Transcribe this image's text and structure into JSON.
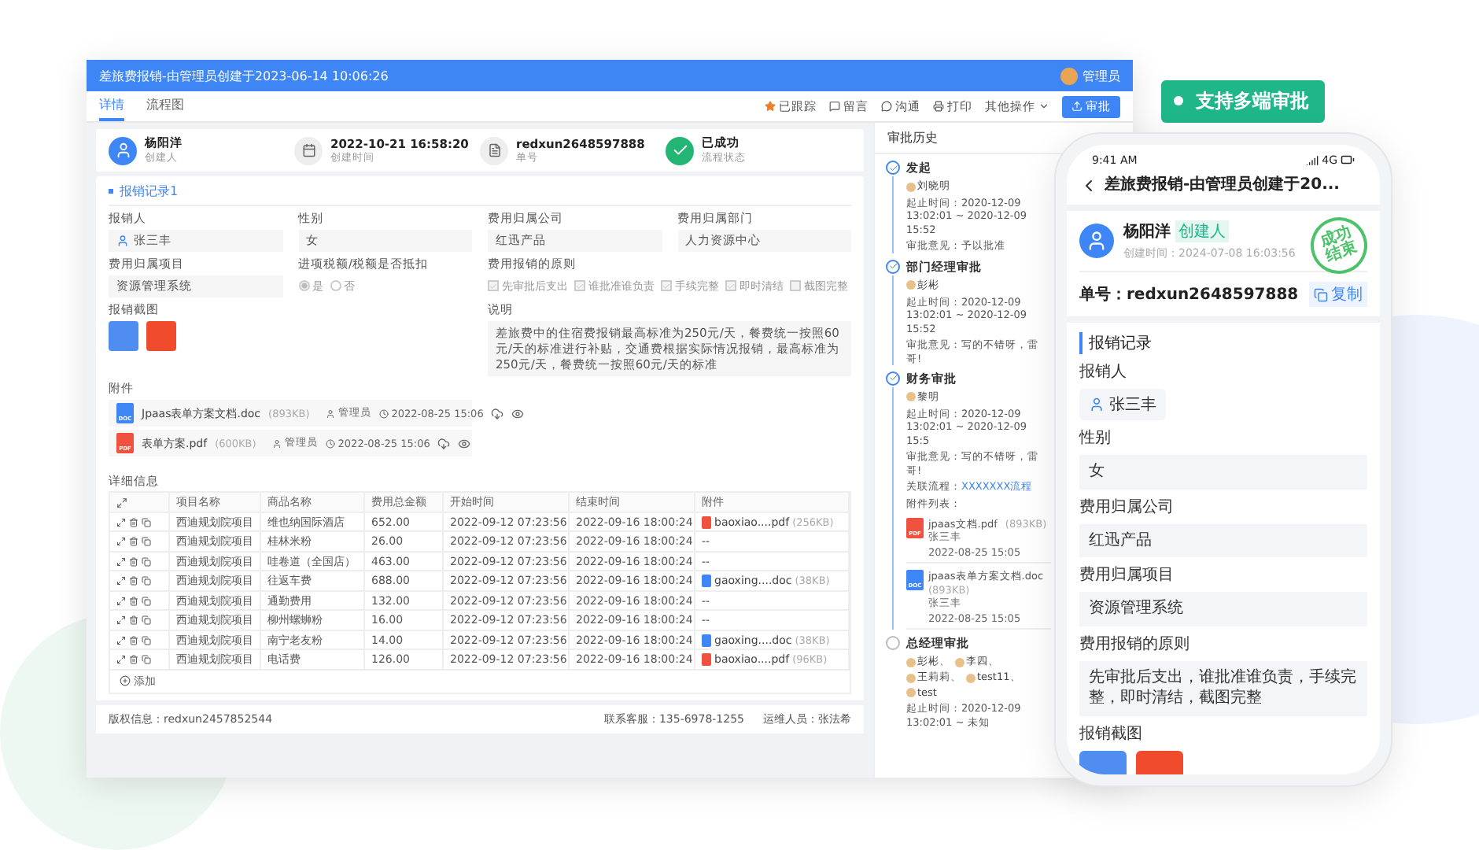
{
  "badge": "支持多端审批",
  "window": {
    "title": "差旅费报销-由管理员创建于2023-06-14 10:06:26",
    "user": "管理员"
  },
  "tabs": [
    {
      "label": "详情",
      "selected": true
    },
    {
      "label": "流程图",
      "selected": false
    }
  ],
  "toolbar": {
    "actions": [
      {
        "kind": "star",
        "label": "已跟踪"
      },
      {
        "kind": "message",
        "label": "留言"
      },
      {
        "kind": "chat",
        "label": "沟通"
      },
      {
        "kind": "print",
        "label": "打印"
      }
    ],
    "more": "其他操作",
    "primary": "审批"
  },
  "summary": [
    {
      "kind": "avatar",
      "value": "杨阳洋",
      "label": "创建人"
    },
    {
      "kind": "calendar",
      "value": "2022-10-21 16:58:20",
      "label": "创建时间"
    },
    {
      "kind": "doc",
      "value": "redxun2648597888",
      "label": "单号"
    },
    {
      "kind": "status",
      "value": "已成功",
      "label": "流程状态"
    }
  ],
  "section": "报销记录1",
  "fields": [
    {
      "kind": "person",
      "label": "报销人",
      "value": "张三丰"
    },
    {
      "kind": "text",
      "label": "性别",
      "value": "女"
    },
    {
      "kind": "text",
      "label": "费用归属公司",
      "value": "红迅产品"
    },
    {
      "kind": "text",
      "label": "费用归属部门",
      "value": "人力资源中心"
    },
    {
      "kind": "text",
      "label": "费用归属项目",
      "value": "资源管理系统"
    },
    {
      "kind": "radio",
      "label": "进项税额/税额是否抵扣",
      "options": [
        {
          "label": "是",
          "selected": true
        },
        {
          "label": "否",
          "selected": false
        }
      ]
    },
    {
      "kind": "checkbox",
      "label": "费用报销的原则",
      "options": [
        {
          "label": "先审批后支出",
          "checked": true
        },
        {
          "label": "谁批准谁负责",
          "checked": true
        },
        {
          "label": "手续完整",
          "checked": true
        },
        {
          "label": "即时清结",
          "checked": true
        },
        {
          "label": "截图完整",
          "checked": false
        }
      ]
    },
    {
      "kind": "images",
      "label": "报销截图"
    },
    {
      "kind": "note",
      "label": "说明",
      "value": "差旅费中的住宿费报销最高标准为250元/天，餐费统一按照60元/天的标准进行补贴，交通费根据实际情况报销，最高标准为250元/天，餐费统一按照60元/天的标准"
    }
  ],
  "attachments": {
    "label": "附件",
    "files": [
      {
        "kind": "doc",
        "icon": "DOC",
        "name": "Jpaas表单方案文档.doc",
        "size": "(893KB)",
        "owner": "管理员",
        "time": "2022-08-25 15:06"
      },
      {
        "kind": "pdf",
        "icon": "PDF",
        "name": "表单方案.pdf",
        "size": "(600KB)",
        "owner": "管理员",
        "time": "2022-08-25 15:06"
      }
    ]
  },
  "details": {
    "label": "详细信息",
    "columns": [
      "项目名称",
      "商品名称",
      "费用总金额",
      "开始时间",
      "结束时间",
      "附件"
    ],
    "rows": [
      {
        "project": "西迪规划院项目",
        "item": "维也纳国际酒店",
        "amount": "652.00",
        "start": "2022-09-12 07:23:56",
        "end": "2022-09-16 18:00:24",
        "file": {
          "kind": "pdf",
          "name": "baoxiao....pdf",
          "size": "(256KB)"
        }
      },
      {
        "project": "西迪规划院项目",
        "item": "桂林米粉",
        "amount": "26.00",
        "start": "2022-09-12 07:23:56",
        "end": "2022-09-16 18:00:24",
        "file": {
          "name": "--"
        }
      },
      {
        "project": "西迪规划院项目",
        "item": "哇卷道（全国店）",
        "amount": "463.00",
        "start": "2022-09-12 07:23:56",
        "end": "2022-09-16 18:00:24",
        "file": {
          "name": "--"
        }
      },
      {
        "project": "西迪规划院项目",
        "item": "往返车费",
        "amount": "688.00",
        "start": "2022-09-12 07:23:56",
        "end": "2022-09-16 18:00:24",
        "file": {
          "kind": "doc",
          "name": "gaoxing....doc",
          "size": "(38KB)"
        }
      },
      {
        "project": "西迪规划院项目",
        "item": "通勤费用",
        "amount": "132.00",
        "start": "2022-09-12 07:23:56",
        "end": "2022-09-16 18:00:24",
        "file": {
          "name": "--"
        }
      },
      {
        "project": "西迪规划院项目",
        "item": "柳州螺蛳粉",
        "amount": "16.00",
        "start": "2022-09-12 07:23:56",
        "end": "2022-09-16 18:00:24",
        "file": {
          "name": "--"
        }
      },
      {
        "project": "西迪规划院项目",
        "item": "南宁老友粉",
        "amount": "14.00",
        "start": "2022-09-12 07:23:56",
        "end": "2022-09-16 18:00:24",
        "file": {
          "kind": "doc",
          "name": "gaoxing....doc",
          "size": "(38KB)"
        }
      },
      {
        "project": "西迪规划院项目",
        "item": "电话费",
        "amount": "126.00",
        "start": "2022-09-12 07:23:56",
        "end": "2022-09-16 18:00:24",
        "file": {
          "kind": "pdf",
          "name": "baoxiao....pdf",
          "size": "(96KB)"
        }
      }
    ],
    "add": "添加"
  },
  "footer": [
    "版权信息：redxun2457852544",
    "联系客服：135-6978-1255",
    "运维人员：张法希"
  ],
  "history": {
    "title": "审批历史",
    "steps": [
      {
        "title": "发起",
        "done": true,
        "people": [
          "刘晓明"
        ],
        "lines": [
          {
            "kind": "text",
            "text": "起止时间：2020-12-09 13:02:01 ~ 2020-12-09 15:52"
          },
          {
            "kind": "text",
            "text": "审批意见：予以批准"
          }
        ]
      },
      {
        "title": "部门经理审批",
        "done": true,
        "people": [
          "彭彬"
        ],
        "lines": [
          {
            "kind": "text",
            "text": "起止时间：2020-12-09 13:02:01 ~ 2020-12-09 15:52"
          },
          {
            "kind": "text",
            "text": "审批意见：写的不错呀，雷哥!"
          }
        ]
      },
      {
        "title": "财务审批",
        "done": true,
        "people": [
          "黎明"
        ],
        "lines": [
          {
            "kind": "text",
            "text": "起止时间：2020-12-09 13:02:01 ~ 2020-12-09 15:5"
          },
          {
            "kind": "text",
            "text": "审批意见：写的不错呀，雷哥!"
          },
          {
            "kind": "link",
            "label": "关联流程：",
            "text": "XXXXXXX流程"
          },
          {
            "kind": "text",
            "text": "附件列表："
          }
        ],
        "files": [
          {
            "kind": "pdf",
            "icon": "PDF",
            "name": "jpaas文档.pdf",
            "size": "(893KB)",
            "owner": "张三丰",
            "time": "2022-08-25 15:05"
          },
          {
            "kind": "doc",
            "icon": "DOC",
            "name": "jpaas表单方案文档.doc",
            "size": "(893KB)",
            "owner": "张三丰",
            "time": "2022-08-25 15:05"
          }
        ]
      },
      {
        "title": "总经理审批",
        "done": false,
        "people": [
          "彭彬、",
          "李四、",
          "王莉莉、",
          "test11、",
          "test"
        ],
        "lines": [
          {
            "kind": "text",
            "text": "起止时间：2020-12-09 13:02:01 ~ 未知"
          }
        ]
      }
    ]
  },
  "phone": {
    "time": "9:41 AM",
    "network": "4G",
    "title": "差旅费报销-由管理员创建于20...",
    "creator": "杨阳洋",
    "tag": "创建人",
    "created": "创建时间：2024-07-08 16:03:56",
    "stamp": "成功结束",
    "number": "单号：redxun2648597888",
    "copy": "复制",
    "section": "报销记录",
    "fields": [
      {
        "kind": "person",
        "label": "报销人",
        "value": "张三丰"
      },
      {
        "kind": "text",
        "label": "性别",
        "value": "女"
      },
      {
        "kind": "text",
        "label": "费用归属公司",
        "value": "红迅产品"
      },
      {
        "kind": "text",
        "label": "费用归属项目",
        "value": "资源管理系统"
      },
      {
        "kind": "text",
        "label": "费用报销的原则",
        "value": "先审批后支出，谁批准谁负责，手续完整，即时清结，截图完整"
      },
      {
        "kind": "images",
        "label": "报销截图"
      }
    ]
  }
}
